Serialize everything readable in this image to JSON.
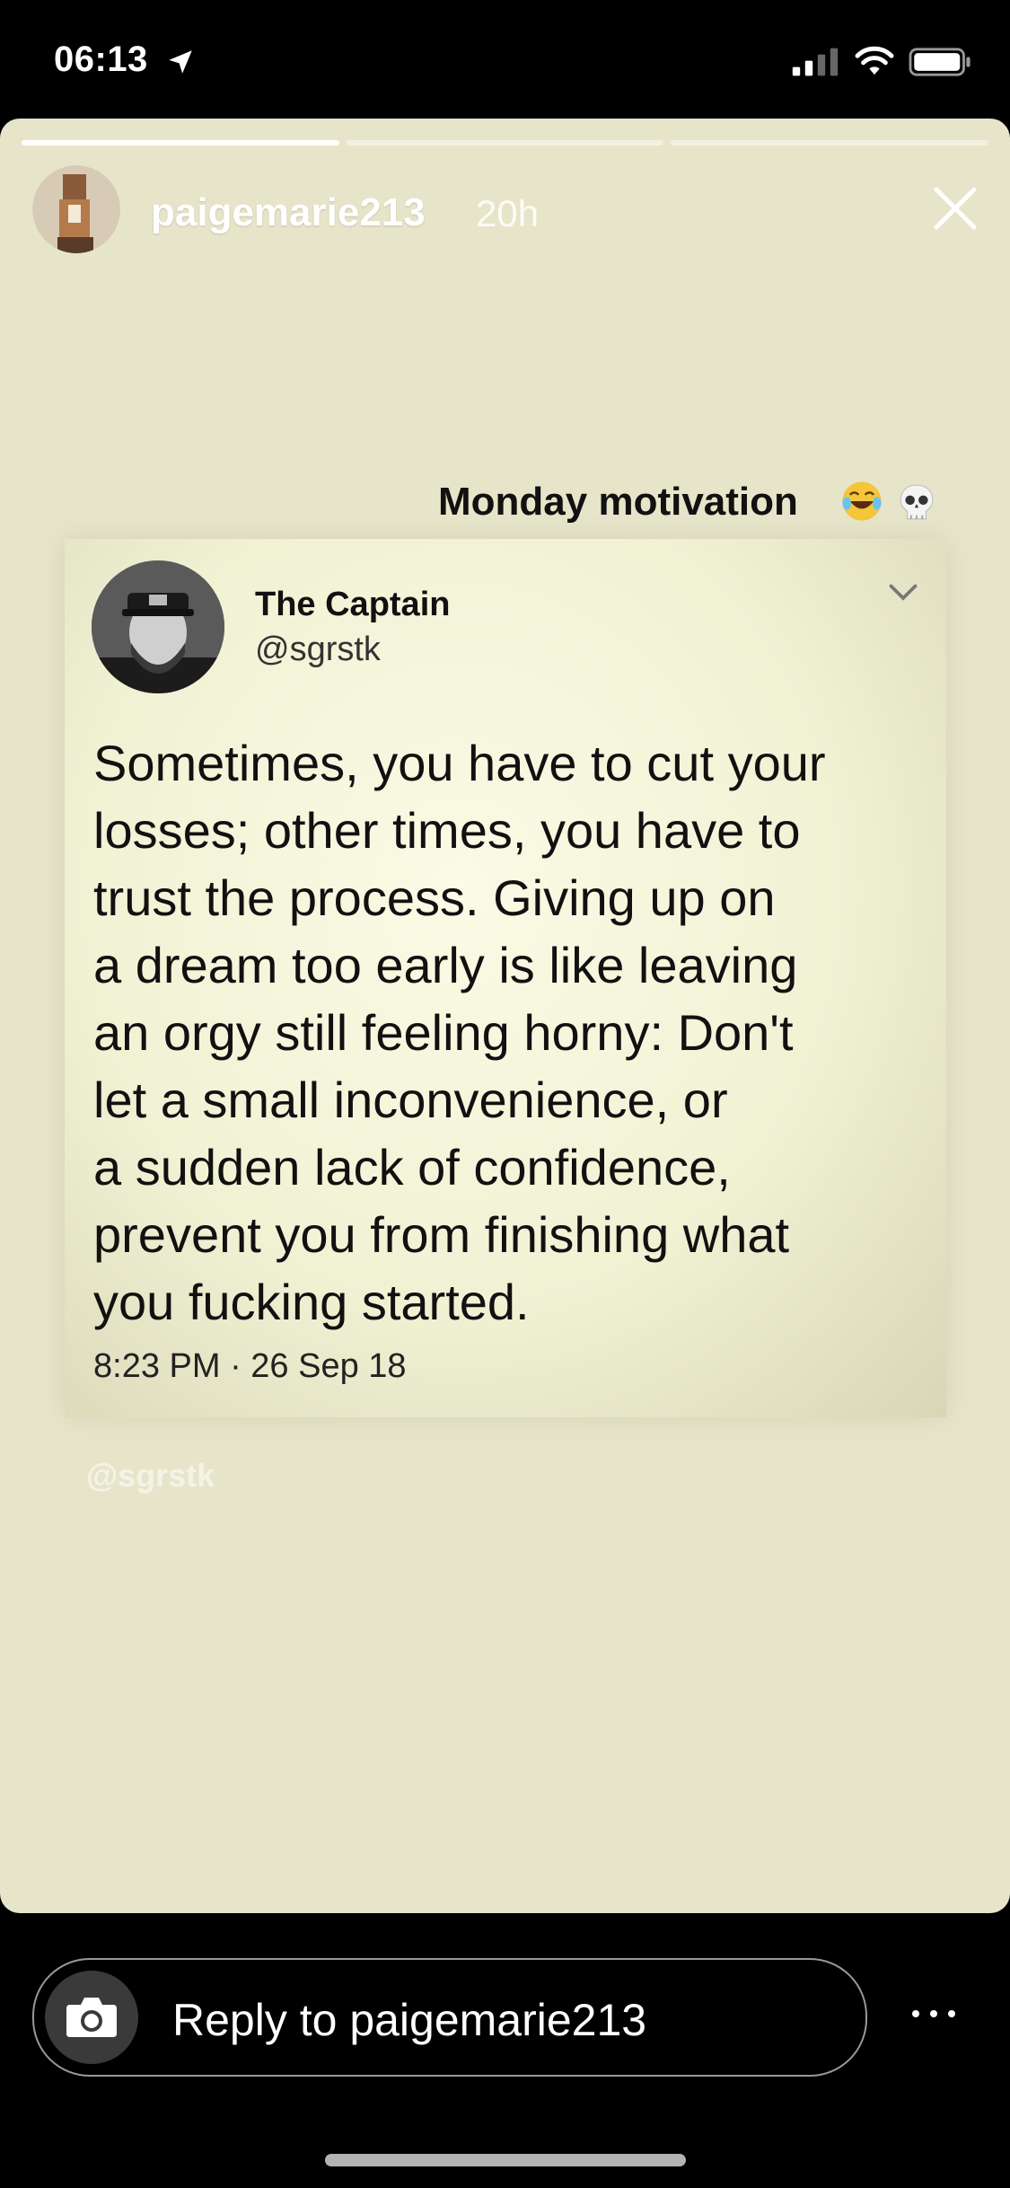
{
  "status_bar": {
    "time": "06:13"
  },
  "story": {
    "progress": [
      1.0,
      0.0,
      0.0
    ],
    "username": "paigemarie213",
    "time_ago": "20h",
    "caption": "Monday motivation",
    "watermark": "@sgrstk"
  },
  "tweet": {
    "name": "The Captain",
    "handle": "@sgrstk",
    "text": "Sometimes, you have to cut your\nlosses; other times, you have to\ntrust the process. Giving up on\na dream too early is like leaving\nan orgy still feeling horny: Don't\nlet a small inconvenience, or\na sudden lack of confidence,\nprevent you from finishing what\nyou fucking started.",
    "timestamp": "8:23 PM · 26 Sep 18"
  },
  "reply": {
    "placeholder": "Reply to paigemarie213"
  },
  "icons": [
    "location-arrow-icon",
    "signal-icon",
    "wifi-icon",
    "battery-icon",
    "close-icon",
    "laugh-emoji-icon",
    "skull-emoji-icon",
    "chevron-down-icon",
    "camera-icon",
    "more-icon"
  ]
}
